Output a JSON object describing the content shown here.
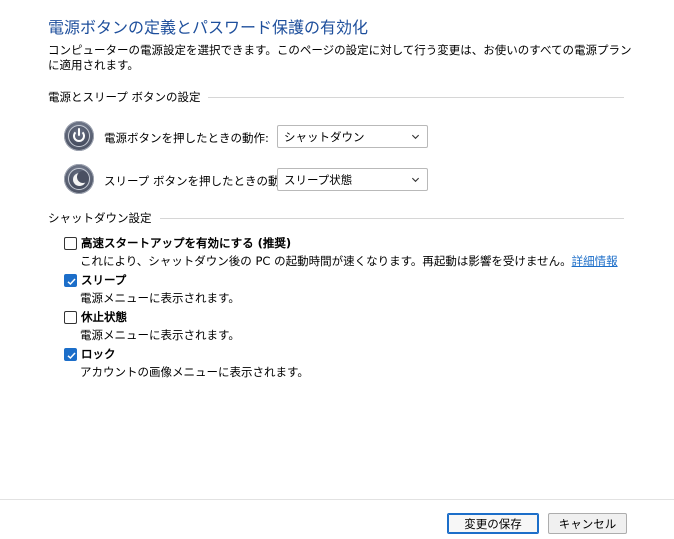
{
  "page": {
    "title": "電源ボタンの定義とパスワード保護の有効化",
    "intro": "コンピューターの電源設定を選択できます。このページの設定に対して行う変更は、お使いのすべての電源プランに適用されます。"
  },
  "power_buttons": {
    "section_title": "電源とスリープ ボタンの設定",
    "power_button_label": "電源ボタンを押したときの動作:",
    "power_button_value": "シャットダウン",
    "sleep_button_label": "スリープ ボタンを押したときの動作:",
    "sleep_button_value": "スリープ状態",
    "icons": [
      "power-icon",
      "sleep-moon-icon"
    ]
  },
  "shutdown": {
    "section_title": "シャットダウン設定",
    "items": [
      {
        "label": "高速スタートアップを有効にする (推奨)",
        "checked": false,
        "description": "これにより、シャットダウン後の PC の起動時間が速くなります。再起動は影響を受けません。",
        "link": "詳細情報"
      },
      {
        "label": "スリープ",
        "checked": true,
        "description": "電源メニューに表示されます。"
      },
      {
        "label": "休止状態",
        "checked": false,
        "description": "電源メニューに表示されます。"
      },
      {
        "label": "ロック",
        "checked": true,
        "description": "アカウントの画像メニューに表示されます。"
      }
    ]
  },
  "footer": {
    "save_label": "変更の保存",
    "cancel_label": "キャンセル"
  },
  "colors": {
    "title": "#1e4f9c",
    "accent": "#1c6ec9"
  }
}
